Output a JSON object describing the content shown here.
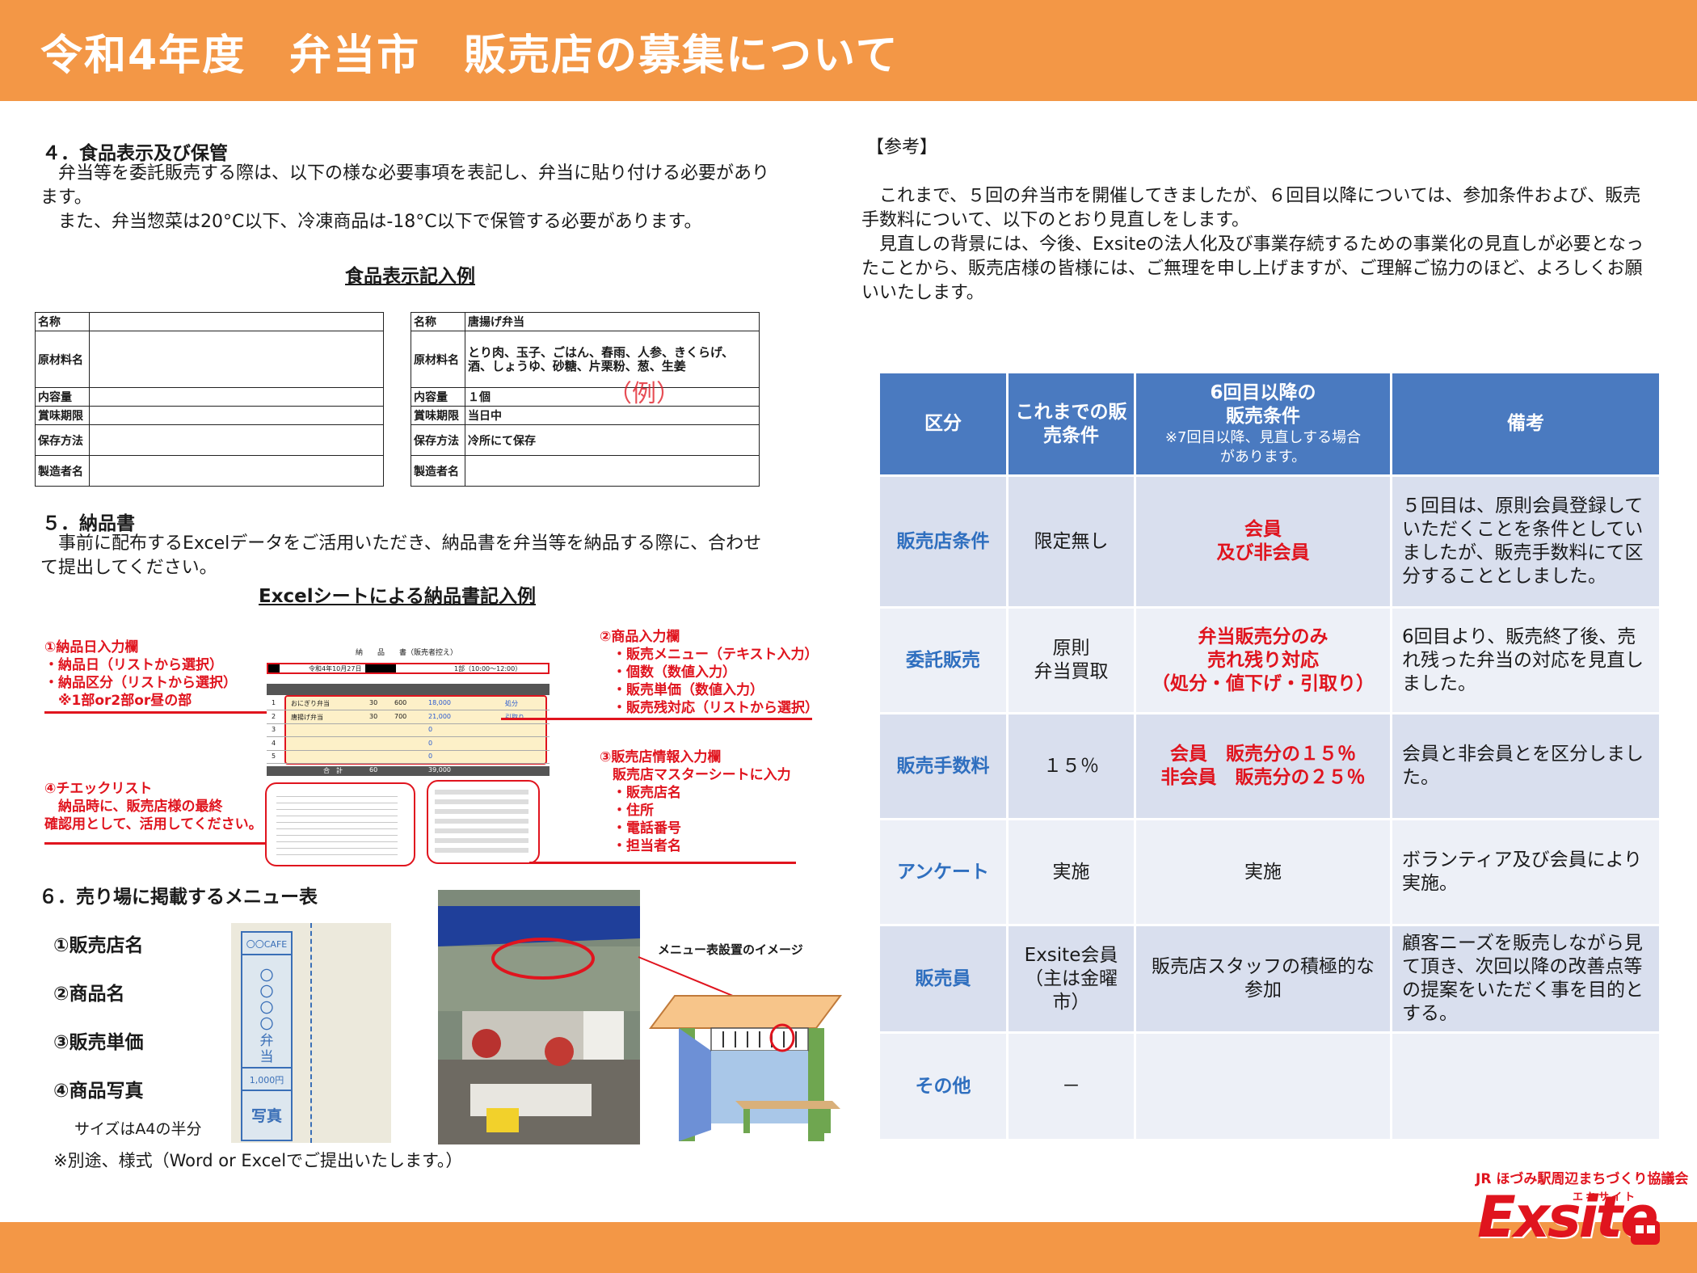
{
  "header": {
    "title": "令和4年度　弁当市　販売店の募集について"
  },
  "section4": {
    "heading": "４．食品表示及び保管",
    "line1": "　弁当等を委託販売する際は、以下の様な必要事項を表記し、弁当に貼り付ける必要があります。",
    "line2": "　また、弁当惣菜は20°C以下、冷凍商品は-18°C以下で保管する必要があります。",
    "example_title": "食品表示記入例",
    "blank_label": {
      "name": "名称",
      "ingredients": "原材料名",
      "amount": "内容量",
      "expiry": "賞味期限",
      "storage": "保存方法",
      "maker": "製造者名"
    },
    "filled_label": {
      "name": "名称",
      "name_val": "唐揚げ弁当",
      "ingredients": "原材料名",
      "ingredients_val": "とり肉、玉子、ごはん、春雨、人参、きくらげ、酒、しょうゆ、砂糖、片栗粉、葱、生姜",
      "amount": "内容量",
      "amount_val": "１個",
      "expiry": "賞味期限",
      "expiry_val": "当日中",
      "storage": "保存方法",
      "storage_val": "冷所にて保存",
      "maker": "製造者名",
      "maker_val": ""
    },
    "stamp": "（例）"
  },
  "section5": {
    "heading": "５．納品書",
    "text": "　事前に配布するExcelデータをご活用いただき、納品書を弁当等を納品する際に、合わせて提出してください。",
    "example_title": "Excelシートによる納品書記入例",
    "note1": [
      "①納品日入力欄",
      "・納品日（リストから選択）",
      "・納品区分（リストから選択）",
      "　※1部or2部or昼の部"
    ],
    "note2": [
      "②商品入力欄",
      "・販売メニュー（テキスト入力）",
      "・個数（数値入力）",
      "・販売単価（数値入力）",
      "・販売残対応（リストから選択）"
    ],
    "note3": [
      "③販売店情報入力欄",
      "販売店マスターシートに入力",
      "・販売店名",
      "・住所",
      "・電話番号",
      "・担当者名"
    ],
    "note4": [
      "④チエックリスト",
      "　納品時に、販売店様の最終",
      "確認用として、活用してください。"
    ],
    "sheet": {
      "title": "納　　品　　書（販売者控え）",
      "date": "令和4年10月27日",
      "slot": "1部（10:00～12:00）",
      "rows": [
        {
          "no": "1",
          "item": "おにぎり弁当",
          "qty": "30",
          "price": "600",
          "amount": "18,000",
          "action": "処分"
        },
        {
          "no": "2",
          "item": "唐揚げ弁当",
          "qty": "30",
          "price": "700",
          "amount": "21,000",
          "action": "引取り"
        },
        {
          "no": "3",
          "item": "",
          "qty": "",
          "price": "",
          "amount": "0",
          "action": ""
        },
        {
          "no": "4",
          "item": "",
          "qty": "",
          "price": "",
          "amount": "0",
          "action": ""
        },
        {
          "no": "5",
          "item": "",
          "qty": "",
          "price": "",
          "amount": "0",
          "action": ""
        }
      ],
      "total_label": "合　計",
      "total_qty": "60",
      "total_amount": "39,000"
    }
  },
  "section6": {
    "heading": "６．売り場に掲載するメニュー表",
    "items": [
      "①販売店名",
      "②商品名",
      "③販売単価",
      "④商品写真"
    ],
    "size_note": "サイズはA4の半分",
    "menu_card": {
      "shop": "〇〇CAFE",
      "product": "〇〇〇〇弁当",
      "price": "1,000円",
      "photo": "写真"
    },
    "image_caption": "メニュー表設置のイメージ",
    "footnote": "※別途、様式（Word or Excelでご提出いたします。）"
  },
  "reference": {
    "heading": "【参考】",
    "p1": "　これまで、５回の弁当市を開催してきましたが、６回目以降については、参加条件および、販売手数料について、以下のとおり見直しをします。",
    "p2": "　見直しの背景には、今後、Exsiteの法人化及び事業存続するための事業化の見直しが必要となったことから、販売店様の皆様には、ご無理を申し上げますが、ご理解ご協力のほど、よろしくお願いいたします。"
  },
  "table": {
    "headers": {
      "col1": "区分",
      "col2": "これまでの販売条件",
      "col3_main": "6回目以降の販売条件",
      "col3_sub": "※7回目以降、見直しする場合があります。",
      "col4": "備考"
    },
    "rows": [
      {
        "cat": "販売店条件",
        "before": "限定無し",
        "after": "会員\n及び非会員",
        "note": "５回目は、原則会員登録していただくことを条件としていましたが、販売手数料にて区分することとしました。"
      },
      {
        "cat": "委託販売",
        "before": "原則\n弁当買取",
        "after": "弁当販売分のみ\n売れ残り対応\n（処分・値下げ・引取り）",
        "note": "6回目より、販売終了後、売れ残った弁当の対応を見直しました。"
      },
      {
        "cat": "販売手数料",
        "before": "１５％",
        "after": "会員　販売分の１５％\n非会員　販売分の２５％",
        "note": "会員と非会員とを区分しました。"
      },
      {
        "cat": "アンケート",
        "before": "実施",
        "after": "実施",
        "note": "ボランティア及び会員により実施。"
      },
      {
        "cat": "販売員",
        "before": "Exsite会員\n（主は金曜市）",
        "after": "販売店スタッフの積極的な参加",
        "note": "顧客ニーズを販売しながら見て頂き、次回以降の改善点等の提案をいただく事を目的とする。"
      },
      {
        "cat": "その他",
        "before": "－",
        "after": "",
        "note": ""
      }
    ]
  },
  "logo": {
    "org": "JR ほづみ駅周辺まちづくり協議会",
    "brand": "Exsite",
    "kana": "エキサイト"
  },
  "colors": {
    "accent": "#f39746",
    "table_header": "#4a7ac0",
    "category_text": "#2f6fbf",
    "highlight": "#e0141e"
  }
}
